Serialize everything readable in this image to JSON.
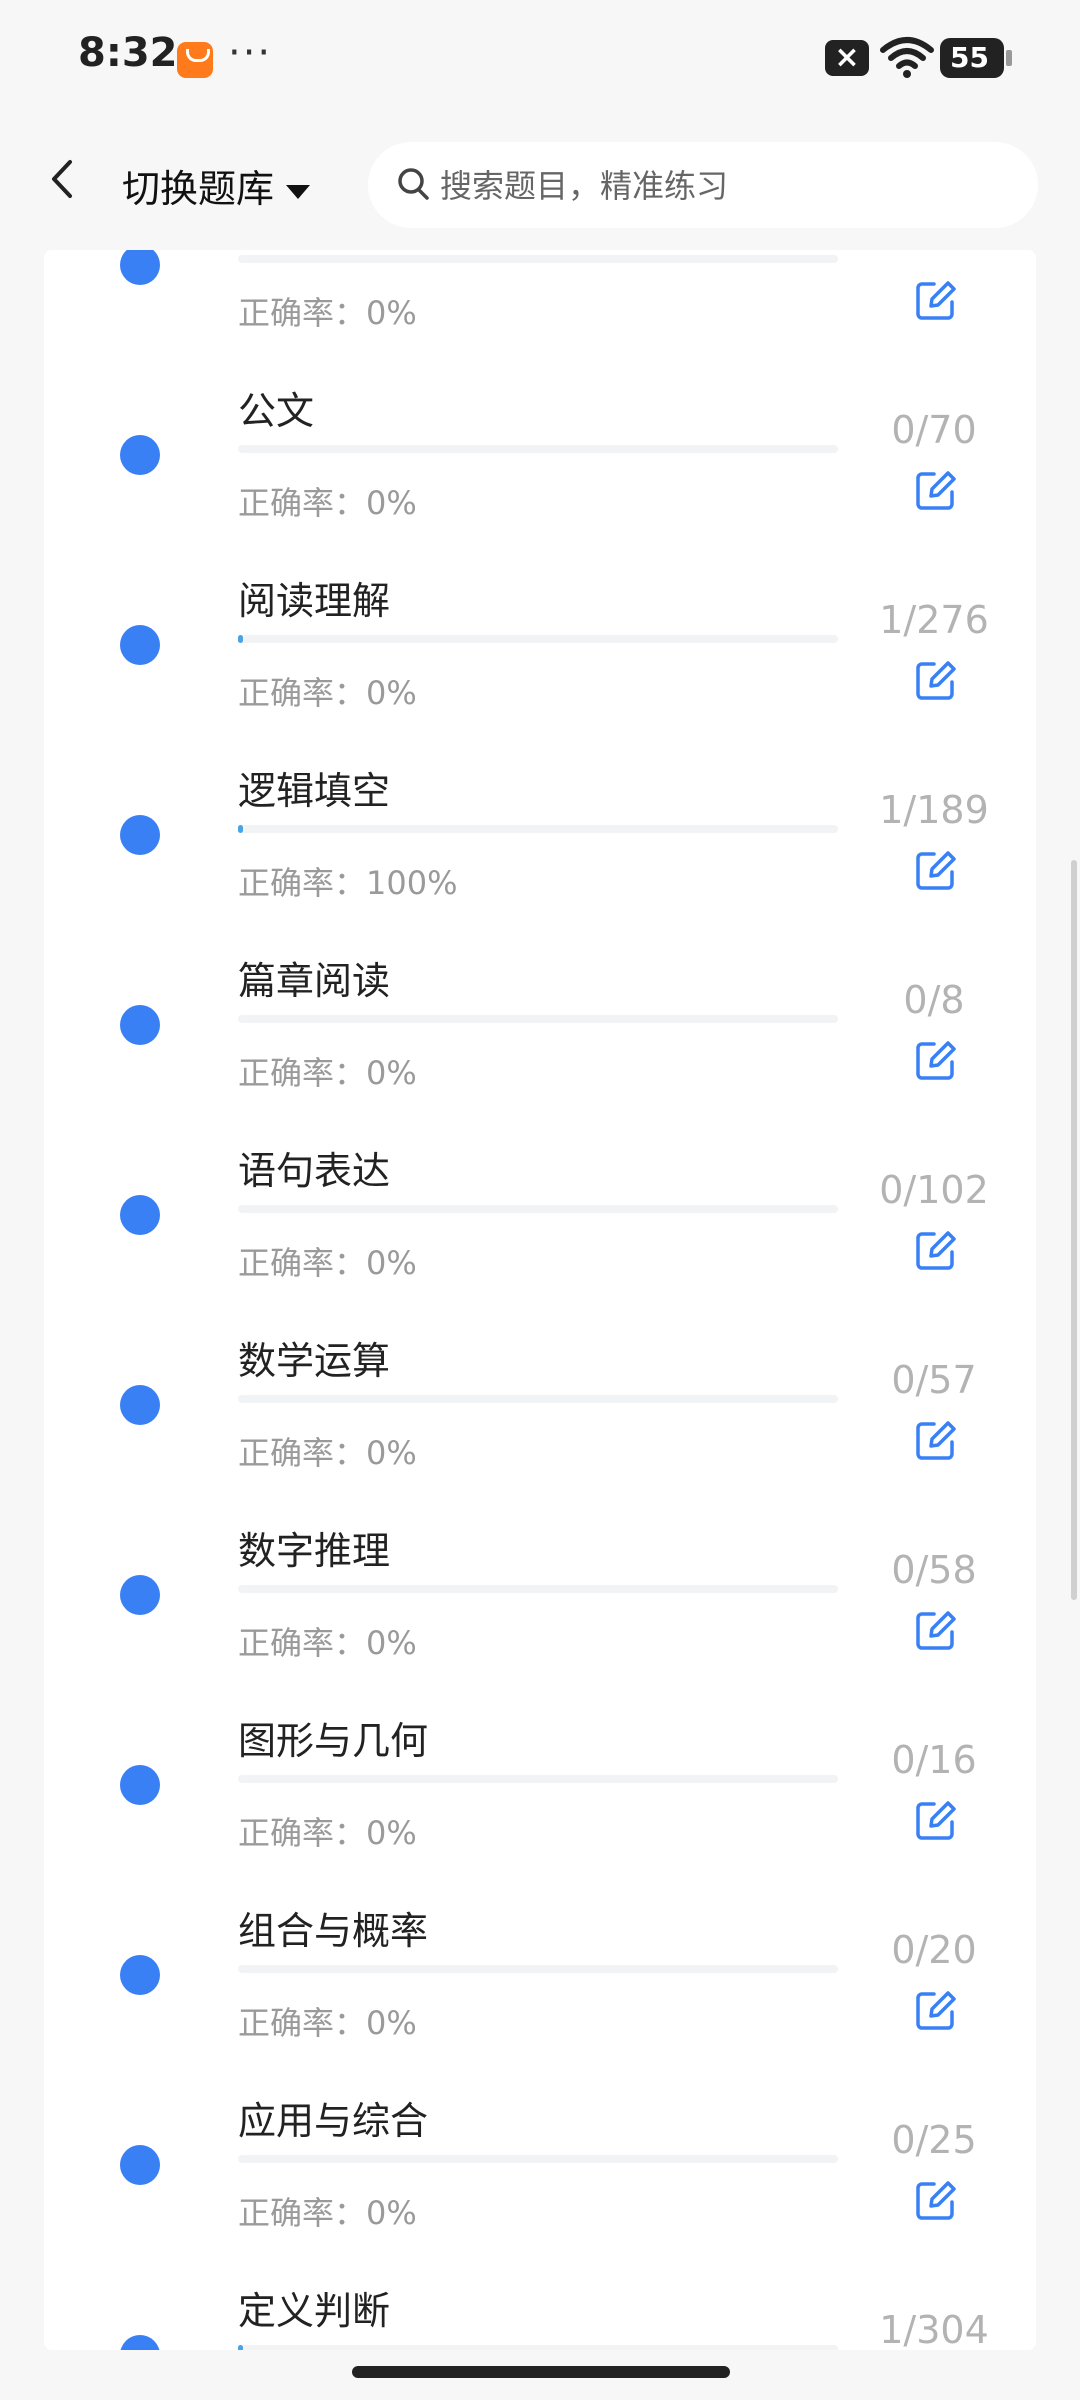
{
  "status_bar": {
    "time": "8:32",
    "overflow": "···",
    "battery": "55",
    "icons": [
      "app-badge-icon",
      "close-icon",
      "wifi-icon",
      "battery-icon"
    ]
  },
  "header": {
    "title": "切换题库",
    "search_placeholder": "搜索题目，精准练习"
  },
  "accuracy_label": "正确率：",
  "items": [
    {
      "name": "",
      "accuracy": "0%",
      "count": "",
      "progress": 0
    },
    {
      "name": "公文",
      "accuracy": "0%",
      "count": "0/70",
      "progress": 0
    },
    {
      "name": "阅读理解",
      "accuracy": "0%",
      "count": "1/276",
      "progress": 0.0036
    },
    {
      "name": "逻辑填空",
      "accuracy": "100%",
      "count": "1/189",
      "progress": 0.0053
    },
    {
      "name": "篇章阅读",
      "accuracy": "0%",
      "count": "0/8",
      "progress": 0
    },
    {
      "name": "语句表达",
      "accuracy": "0%",
      "count": "0/102",
      "progress": 0
    },
    {
      "name": "数学运算",
      "accuracy": "0%",
      "count": "0/57",
      "progress": 0
    },
    {
      "name": "数字推理",
      "accuracy": "0%",
      "count": "0/58",
      "progress": 0
    },
    {
      "name": "图形与几何",
      "accuracy": "0%",
      "count": "0/16",
      "progress": 0
    },
    {
      "name": "组合与概率",
      "accuracy": "0%",
      "count": "0/20",
      "progress": 0
    },
    {
      "name": "应用与综合",
      "accuracy": "0%",
      "count": "0/25",
      "progress": 0
    },
    {
      "name": "定义判断",
      "accuracy": "",
      "count": "1/304",
      "progress": 0.0033
    }
  ],
  "colors": {
    "accent": "#3A80F5",
    "progress": "#49A3E6",
    "muted": "#9A9A9A"
  }
}
